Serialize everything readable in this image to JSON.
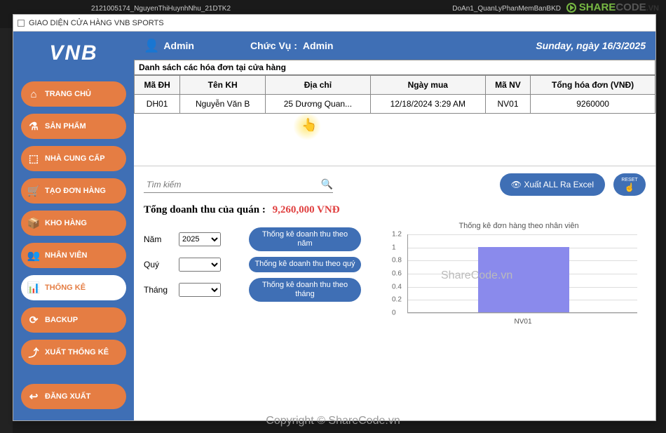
{
  "watermark_top": {
    "share": "SHARE",
    "code": "CODE",
    "vn": ".VN"
  },
  "tab_bg": "2121005174_NguyenThiHuynhNhu_21DTK2",
  "tab_bg2": "DoAn1_QuanLyPhanMemBanBKD",
  "window_title": "GIAO DIỆN CỬA HÀNG VNB SPORTS",
  "logo": "VNB",
  "sidebar": {
    "items": [
      {
        "icon": "⌂",
        "label": "TRANG CHỦ"
      },
      {
        "icon": "⚗",
        "label": "SẢN PHẨM"
      },
      {
        "icon": "⬚",
        "label": "NHÀ CUNG CẤP"
      },
      {
        "icon": "🛒",
        "label": "TẠO ĐƠN HÀNG"
      },
      {
        "icon": "📦",
        "label": "KHO HÀNG"
      },
      {
        "icon": "👥",
        "label": "NHÂN VIÊN"
      },
      {
        "icon": "📊",
        "label": "THỐNG KÊ"
      },
      {
        "icon": "⟳",
        "label": "BACKUP"
      },
      {
        "icon": "⤴",
        "label": "XUẤT THỐNG KÊ"
      }
    ],
    "logout_icon": "↩",
    "logout_label": "ĐĂNG XUẤT"
  },
  "header": {
    "user_icon": "👤",
    "user": "Admin",
    "role_label": "Chức Vụ :",
    "role": "Admin",
    "date": "Sunday, ngày 16/3/2025"
  },
  "section_title": "Danh sách các hóa đơn tại cửa hàng",
  "table": {
    "headers": [
      "Mã ĐH",
      "Tên KH",
      "Địa chỉ",
      "Ngày mua",
      "Mã NV",
      "Tổng hóa đơn (VNĐ)"
    ],
    "rows": [
      [
        "DH01",
        "Nguyễn Văn B",
        "25 Dương Quan...",
        "12/18/2024 3:29 AM",
        "NV01",
        "9260000"
      ]
    ]
  },
  "search": {
    "placeholder": "Tìm kiếm",
    "icon": "🔍"
  },
  "export_btn": {
    "icon": "👁",
    "label": "Xuất ALL Ra Excel"
  },
  "reset_btn": {
    "label": "RESET",
    "icon": "☝"
  },
  "revenue": {
    "label": "Tổng doanh thu của quán :",
    "value": "9,260,000 VNĐ"
  },
  "filters": {
    "year_label": "Năm",
    "year_value": "2025",
    "year_btn": "Thống kê doanh thu theo năm",
    "quarter_label": "Quý",
    "quarter_value": "",
    "quarter_btn": "Thống kê doanh thu theo quý",
    "month_label": "Tháng",
    "month_value": "",
    "month_btn": "Thống kê doanh thu theo tháng"
  },
  "chart_data": {
    "type": "bar",
    "title": "Thống kê đơn hàng theo nhân viên",
    "categories": [
      "NV01"
    ],
    "values": [
      1
    ],
    "ylim": [
      0,
      1.2
    ],
    "yticks": [
      0,
      0.2,
      0.4,
      0.6,
      0.8,
      1,
      1.2
    ]
  },
  "chart_watermark": "ShareCode.vn",
  "copyright": "Copyright © ShareCode.vn"
}
